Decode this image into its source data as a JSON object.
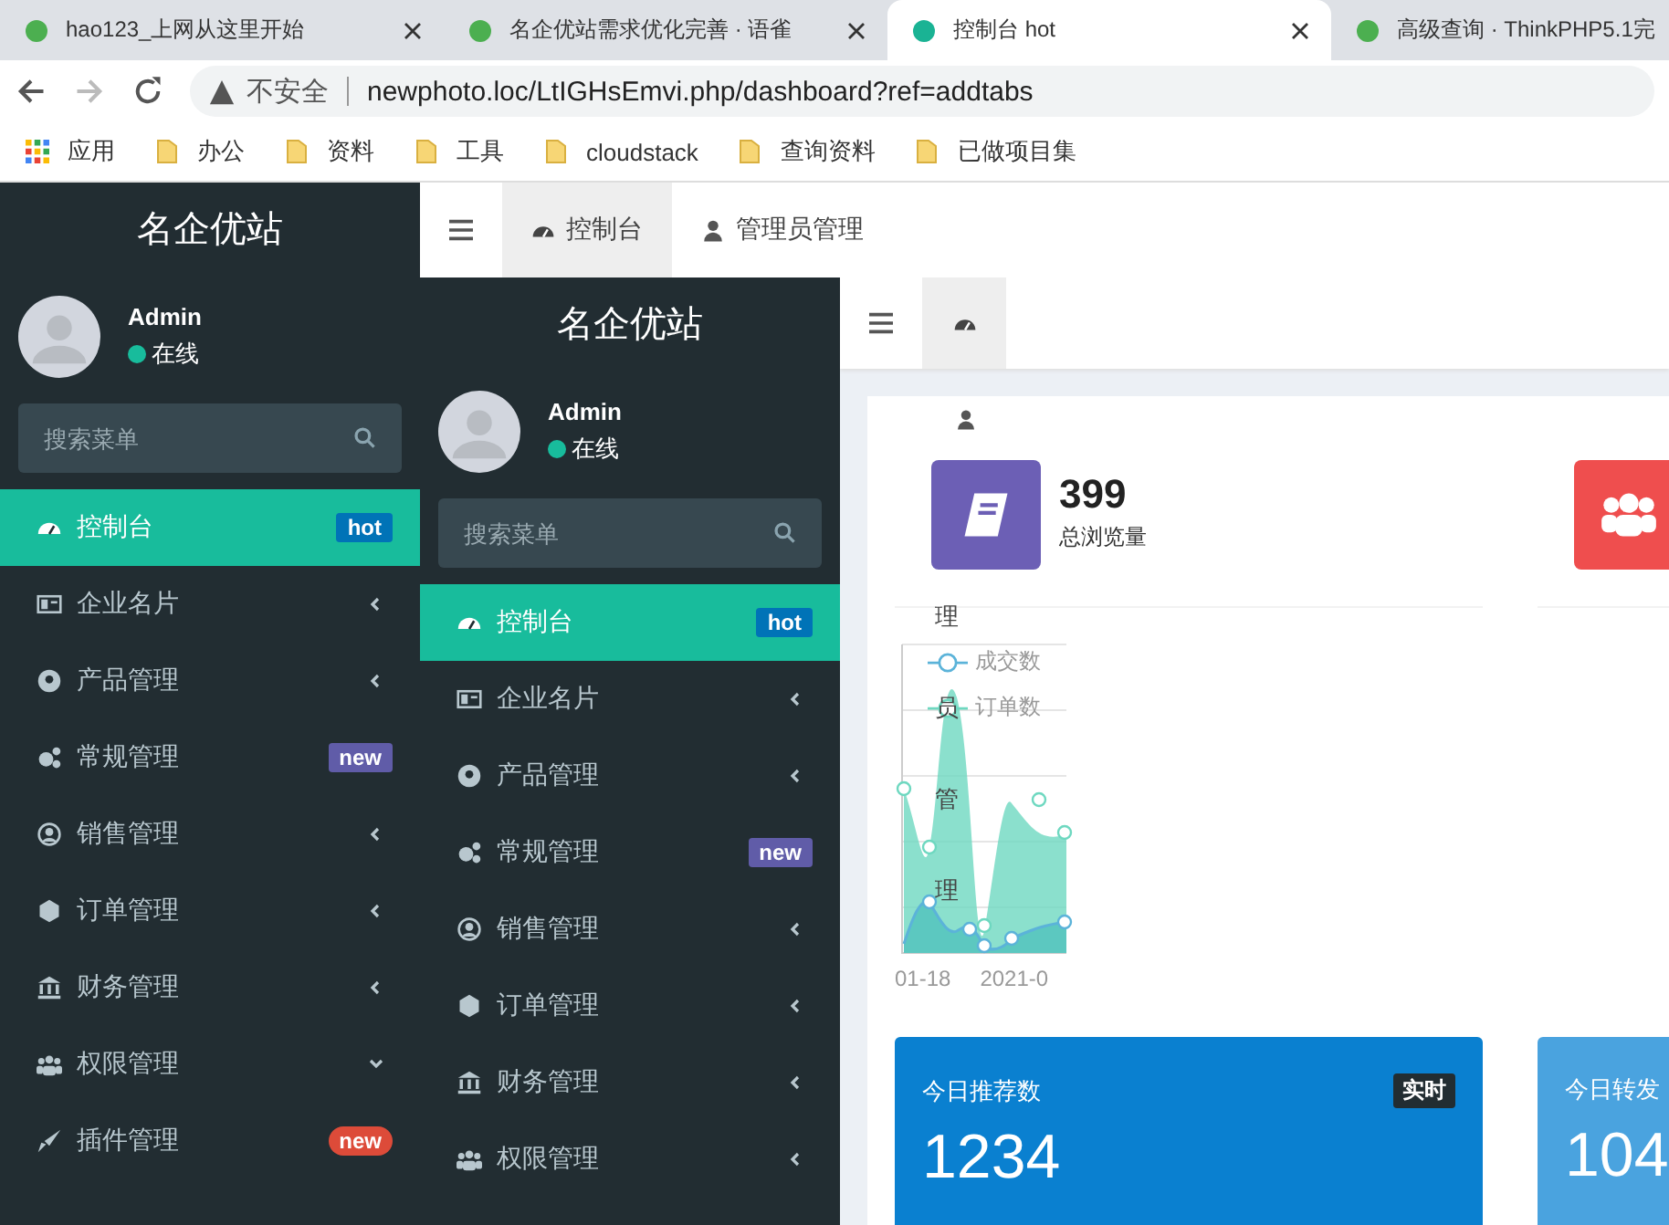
{
  "browser": {
    "tabs": [
      {
        "title": "hao123_上网从这里开始",
        "selected": false
      },
      {
        "title": "名企优站需求优化完善 · 语雀",
        "selected": false
      },
      {
        "title": "控制台 hot",
        "selected": true
      },
      {
        "title": "高级查询 · ThinkPHP5.1完",
        "selected": false
      }
    ],
    "security": "不安全",
    "url": "newphoto.loc/LtIGHsEmvi.php/dashboard?ref=addtabs",
    "bookmarks": [
      "应用",
      "办公",
      "资料",
      "工具",
      "cloudstack",
      "查询资料",
      "已做项目集"
    ]
  },
  "sidebar": {
    "logo": "名企优站",
    "user": "Admin",
    "status": "在线",
    "search_placeholder": "搜索菜单",
    "items": [
      {
        "label": "控制台",
        "selected": true,
        "badge": {
          "text": "hot",
          "color": "#0073b7"
        }
      },
      {
        "label": "企业名片",
        "selected": false,
        "expanded": false
      },
      {
        "label": "产品管理",
        "selected": false,
        "expanded": false
      },
      {
        "label": "常规管理",
        "selected": false,
        "badge": {
          "text": "new",
          "color": "#605ca8"
        }
      },
      {
        "label": "销售管理",
        "selected": false,
        "expanded": false
      },
      {
        "label": "订单管理",
        "selected": false,
        "expanded": false
      },
      {
        "label": "财务管理",
        "selected": false,
        "expanded": false
      },
      {
        "label": "权限管理",
        "selected": false,
        "expanded": true
      },
      {
        "label": "插件管理",
        "selected": false,
        "badge": {
          "text": "new",
          "color": "#dd4b39"
        }
      }
    ]
  },
  "top_nav": {
    "tabs": [
      {
        "label": "控制台",
        "selected": true
      },
      {
        "label": "管理员管理",
        "selected": false
      }
    ]
  },
  "inner_sidebar": {
    "logo": "名企优站",
    "user": "Admin",
    "status": "在线",
    "search_placeholder": "搜索菜单",
    "items": [
      {
        "label": "控制台",
        "selected": true,
        "badge": {
          "text": "hot",
          "color": "#0073b7"
        }
      },
      {
        "label": "企业名片",
        "selected": false,
        "expanded": false
      },
      {
        "label": "产品管理",
        "selected": false,
        "expanded": false
      },
      {
        "label": "常规管理",
        "selected": false,
        "badge": {
          "text": "new",
          "color": "#605ca8"
        }
      },
      {
        "label": "销售管理",
        "selected": false,
        "expanded": false
      },
      {
        "label": "订单管理",
        "selected": false,
        "expanded": false
      },
      {
        "label": "财务管理",
        "selected": false,
        "expanded": false
      },
      {
        "label": "权限管理",
        "selected": false,
        "expanded": false
      }
    ]
  },
  "inner_nav": {
    "tabs": [
      {
        "selected": true
      }
    ]
  },
  "overflow_label": "理员管理",
  "stats": [
    {
      "value": "399",
      "label": "总浏览量",
      "color": "#6c5fb5"
    },
    {
      "color": "#ef4e4e"
    }
  ],
  "chart": {
    "legend": [
      {
        "name": "成交数",
        "color": "#5bb3d9"
      },
      {
        "name": "订单数",
        "color": "#6ed8c0"
      }
    ],
    "x_labels": [
      "01-18",
      "2021-0"
    ]
  },
  "cards": [
    {
      "title": "今日推荐数",
      "badge": "实时",
      "value": "1234",
      "color": "#0a80d0"
    },
    {
      "title": "今日转发",
      "value": "104",
      "color": "#4aa3df"
    }
  ]
}
